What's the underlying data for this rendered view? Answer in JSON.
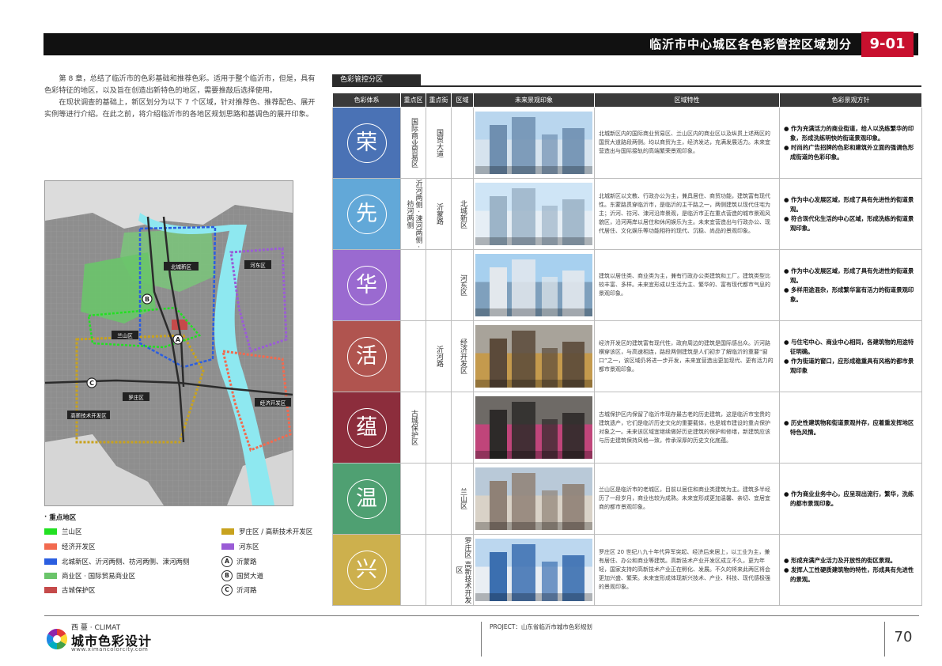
{
  "header": {
    "title": "临沂市中心城区各色彩管控区域划分",
    "page_code": "9-01"
  },
  "intro": {
    "paragraphs": [
      "第 8 章，总结了临沂市的色彩基础和推荐色彩。适用于整个临沂市，但是，具有色彩特征的地区，以及旨在创造出新特色的地区，需要推敲后选择使用。",
      "在现状调查的基础上，新区划分为以下 7 个区域，针对推荐色、推荐配色、展开实例等进行介绍。在此之前，将介绍临沂市的各地区规划思路和基调色的展开印象。"
    ]
  },
  "map": {
    "labels": [
      "北城新区",
      "河东区",
      "兰山区",
      "罗庄区",
      "高新技术开发区",
      "经济开发区"
    ],
    "markers": [
      "A",
      "B",
      "C"
    ]
  },
  "legend": {
    "title": "重点地区",
    "items": [
      {
        "label": "兰山区",
        "color": "#22e022"
      },
      {
        "label": "罗庄区 / 高新技术开发区",
        "color": "#c8a21e"
      },
      {
        "label": "经济开发区",
        "color": "#f26a4f"
      },
      {
        "label": "河东区",
        "color": "#9a5cd6"
      },
      {
        "label": "北城新区、沂河两侧、祊河两侧、涑河两侧",
        "color": "#2b5ee0"
      },
      {
        "label": "商业区 · 国际贸易商业区",
        "color": "#6ac46a"
      },
      {
        "label": "古城保护区",
        "color": "#c54a4a"
      }
    ],
    "roads": [
      {
        "marker": "A",
        "label": "沂蒙路"
      },
      {
        "marker": "B",
        "label": "国贸大道"
      },
      {
        "marker": "C",
        "label": "沂河路"
      }
    ]
  },
  "table": {
    "tab_title": "色彩管控分区",
    "headers": [
      "色彩体系",
      "重点区",
      "重点街",
      "区域",
      "未来景观印象",
      "区域特性",
      "色彩景观方针"
    ],
    "rows": [
      {
        "char": "荣",
        "color": "#4a72b5",
        "key_area": "国际商业贸易区",
        "key_street": "国贸大道",
        "region": "",
        "desc": "北城新区内的国际商业贸易区、兰山区内的商业区以及纵贯上述两区的国贸大道路段两侧。均以商贸为主，经济发达，充满发展活力。未来宜营造出与国际接轨的高端繁荣景观印象。",
        "strategy": [
          "作为充满活力的商业街道，给人以洗练繁华的印象，形成洗练明快的街道景观印象。",
          "时尚的广告招牌的色彩和建筑外立面的强调色形成街道的色彩印象。"
        ]
      },
      {
        "char": "先",
        "color": "#62a8d8",
        "key_area": "沂河两侧 · 涑河两侧 · 祊河两侧",
        "key_street": "沂蒙路",
        "region": "北城新区",
        "desc": "北城新区以文教、行政办公为主，兼具居住、商贸功能，建筑富有现代性。东蒙路贯穿临沂市，是临沂的主干路之一，两侧建筑以现代住宅为主；沂河、祊河、涑河沿岸景观，是临沂市正在重点营造的城市景观风貌区，沿河两岸以居住和休闲娱乐为主。未来宜营造出与行政办公、现代居住、文化娱乐等功能相符的现代、沉稳、尚品的景观印象。",
        "strategy": [
          "作为中心发展区域，形成了具有先进性的街道景观。",
          "符合现代化生活的中心区域，形成洗练的街道景观印象。"
        ]
      },
      {
        "char": "华",
        "color": "#9a6ad0",
        "key_area": "",
        "key_street": "",
        "region": "河东区",
        "desc": "建筑以居住类、商业类为主，兼有行政办公类建筑和工厂。建筑类型比较丰富、多样。未来宜形成以生活为主、繁华的、富有现代都市气息的景观印象。",
        "strategy": [
          "作为中心发展区域，形成了具有先进性的街道景观。",
          "多样用途混杂，形成繁华富有活力的街道景观印象。"
        ]
      },
      {
        "char": "活",
        "color": "#b0544f",
        "key_area": "",
        "key_street": "沂河路",
        "region": "经济开发区",
        "desc": "经济开发区的建筑富有现代性，政府周边的建筑是国际感出众。沂河路横穿该区，与高速相连，路段两侧建筑是人们初步了解临沂的重要“窗口”之一，该区域仍将进一步开发，未来宜营造出更加现代、更有活力的都市景观印象。",
        "strategy": [
          "与住宅中心、商业中心相同，各建筑物的用途特征明确。",
          "作为街道的窗口，应形成稳重具有风格的都市景观印象"
        ]
      },
      {
        "char": "蕴",
        "color": "#8c2d3c",
        "key_area": "古城保护区",
        "key_street": "",
        "region": "",
        "desc": "古城保护区内保留了临沂市现存最古老的历史建筑，这是临沂市宝贵的建筑遗产，它们是临沂历史文化的重要载体，也是城市建设的重点保护对象之一。未来该区域宜继续做好历史建筑的保护和修缮，新建筑应该与历史建筑保持风格一致，传承深厚的历史文化底蕴。",
        "strategy": [
          "历史性建筑物和街道景观并存，应着重发挥地区特色风情。"
        ]
      },
      {
        "char": "温",
        "color": "#4fa072",
        "key_area": "",
        "key_street": "",
        "region": "兰山区",
        "desc": "兰山区是临沂市的老城区，目前以居住和商业类建筑为主。建筑多半经历了一段岁月，商业也较为成熟。未来宜形成更加温馨、亲切、宜居宜商的都市景观印象。",
        "strategy": [
          "作为商业业务中心，应呈现出流行，繁华，洗练的都市景观印象。"
        ]
      },
      {
        "char": "兴",
        "color": "#cdb04d",
        "key_area": "",
        "key_street": "",
        "region": "罗庄区 高新技术开发区",
        "desc": "罗庄区 20 世纪八九十年代异军突起、经济后来居上，以工业为主，兼有居住、办公和商业等建筑。高新技术产业开发区成立不久，更为年轻，国家支持的高新技术产业正在孵化、发展。不久的将来此两区将会更加兴盛、繁荣。未来宜形成体现新兴技术、产业、科技、现代感极强的景观印象。",
        "strategy": [
          "形成充满产业活力及开放性的街区景观。",
          "发挥人工性硬质建筑物的特性，形成具有先进性的景观。"
        ]
      }
    ]
  },
  "footer": {
    "logo_small": "西 蔓 · CLIMAT",
    "logo_big": "城市色彩设计",
    "logo_url": "www.ximancolorcity.com",
    "project": "PROJECT：山东省临沂市城市色彩规划",
    "page": "70"
  }
}
